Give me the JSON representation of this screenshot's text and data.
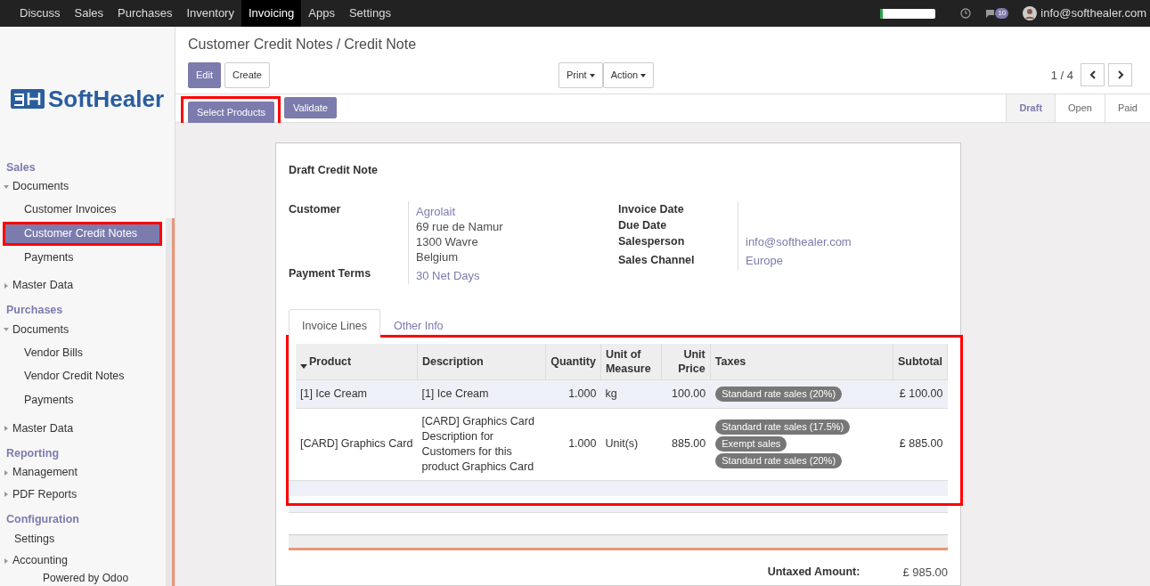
{
  "top_menu": [
    {
      "label": "Discuss",
      "selected": false
    },
    {
      "label": "Sales",
      "selected": false
    },
    {
      "label": "Purchases",
      "selected": false
    },
    {
      "label": "Inventory",
      "selected": false
    },
    {
      "label": "Invoicing",
      "selected": true
    },
    {
      "label": "Apps",
      "selected": false
    },
    {
      "label": "Settings",
      "selected": false
    }
  ],
  "systray": {
    "progress": {
      "level": 0.05
    },
    "chat_count": "10",
    "user": "info@softhealer.com"
  },
  "logo": {
    "text": "SoftHealer"
  },
  "sidebar": [
    {
      "heading": "Sales",
      "items": [
        {
          "label": "Documents",
          "expanded": true,
          "children": [
            {
              "label": "Customer Invoices",
              "selected": false
            },
            {
              "label": "Customer Credit Notes",
              "selected": true,
              "highlighted": true
            },
            {
              "label": "Payments",
              "selected": false
            }
          ]
        },
        {
          "label": "Master Data",
          "expanded": false
        }
      ]
    },
    {
      "heading": "Purchases",
      "items": [
        {
          "label": "Documents",
          "expanded": true,
          "children": [
            {
              "label": "Vendor Bills",
              "selected": false
            },
            {
              "label": "Vendor Credit Notes",
              "selected": false
            },
            {
              "label": "Payments",
              "selected": false
            }
          ]
        },
        {
          "label": "Master Data",
          "expanded": false
        }
      ]
    },
    {
      "heading": "Reporting",
      "items": [
        {
          "label": "Management",
          "expanded": false
        },
        {
          "label": "PDF Reports",
          "expanded": false
        }
      ]
    },
    {
      "heading": "Configuration",
      "items": [
        {
          "label": "Settings"
        },
        {
          "label": "Accounting",
          "expanded": false
        }
      ]
    }
  ],
  "sidebar_footer": "Powered by Odoo",
  "breadcrumb": [
    "Customer Credit Notes",
    "Credit Note"
  ],
  "breadcrumb_separator": "/",
  "buttons": [
    {
      "label": "Edit",
      "kind": "primary"
    },
    {
      "label": "Create",
      "kind": "secondary"
    }
  ],
  "dropdowns": [
    "Print",
    "Action"
  ],
  "pager": "1 / 4",
  "status_buttons": [
    {
      "label": "Select Products",
      "highlighted": true
    },
    {
      "label": "Validate",
      "highlighted": false
    }
  ],
  "stages": [
    {
      "label": "Draft",
      "selected": true
    },
    {
      "label": "Open",
      "selected": false
    },
    {
      "label": "Paid",
      "selected": false
    }
  ],
  "form": {
    "title": "Draft Credit Note",
    "left_fields": [
      {
        "label": "Customer",
        "lines": [
          {
            "text": "Agrolait",
            "link": true
          },
          {
            "text": "69 rue de Namur",
            "link": false
          },
          {
            "text": "1300 Wavre",
            "link": false
          },
          {
            "text": "Belgium",
            "link": false
          }
        ]
      },
      {
        "label": "Payment Terms",
        "lines": [
          {
            "text": "30 Net Days",
            "link": true
          }
        ]
      }
    ],
    "right_fields": [
      {
        "label": "Invoice Date"
      },
      {
        "label": "Due Date"
      },
      {
        "label": "Salesperson",
        "lines": [
          {
            "text": "info@softhealer.com",
            "link": true
          }
        ]
      },
      {
        "label": "Sales Channel",
        "lines": [
          {
            "text": "Europe",
            "link": true
          }
        ]
      }
    ],
    "tabs": [
      {
        "label": "Invoice Lines",
        "selected": true
      },
      {
        "label": "Other Info",
        "selected": false
      }
    ],
    "table": {
      "highlighted": true,
      "columns": [
        "Product",
        "Description",
        "Quantity",
        "Unit of Measure",
        "Unit Price",
        "Taxes",
        "Subtotal"
      ],
      "rows": [
        {
          "selected": true,
          "product": "[1] Ice Cream",
          "description": "[1] Ice Cream",
          "quantity": "1.000",
          "uom": "kg",
          "unit_price": "100.00",
          "taxes": [
            "Standard rate sales (20%)"
          ],
          "subtotal": "£ 100.00"
        },
        {
          "selected": false,
          "product": "[CARD] Graphics Card",
          "description": "[CARD] Graphics Card Description for Customers for this product Graphics Card",
          "quantity": "1.000",
          "uom": "Unit(s)",
          "unit_price": "885.00",
          "taxes": [
            "Standard rate sales (17.5%)",
            "Exempt sales",
            "Standard rate sales (20%)"
          ],
          "subtotal": "£ 885.00"
        }
      ]
    },
    "totals": [
      {
        "label": "Untaxed Amount:",
        "value": "£ 985.00"
      }
    ]
  }
}
